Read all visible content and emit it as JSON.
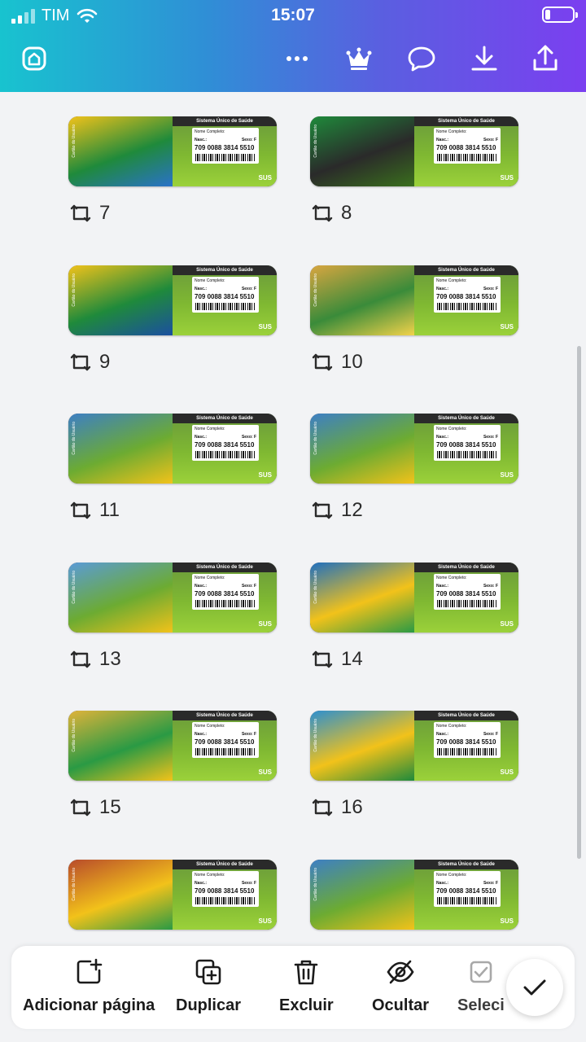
{
  "status_bar": {
    "carrier": "TIM",
    "time": "15:07"
  },
  "toolbar": {
    "icons": [
      "home-icon",
      "more-icon",
      "crown-icon",
      "comment-icon",
      "download-icon",
      "share-icon"
    ]
  },
  "card_text": {
    "system": "Sistema Único de Saúde",
    "name_label": "Nome Completo:",
    "birth_label": "Nasc.:",
    "sex_label": "Sexo: F",
    "number": "709 0088 3814 5510",
    "sus": "SUS",
    "side": "Cartão do Usuário"
  },
  "pages": [
    {
      "label": "7"
    },
    {
      "label": "8"
    },
    {
      "label": "9"
    },
    {
      "label": "10"
    },
    {
      "label": "11"
    },
    {
      "label": "12"
    },
    {
      "label": "13"
    },
    {
      "label": "14"
    },
    {
      "label": "15"
    },
    {
      "label": "16"
    },
    {
      "label": ""
    },
    {
      "label": ""
    }
  ],
  "actions": {
    "add_page": "Adicionar página",
    "duplicate": "Duplicar",
    "delete": "Excluir",
    "hide": "Ocultar",
    "select": "Seleci"
  },
  "colors": {
    "header_start": "#18c3cf",
    "header_end": "#7b3ff0",
    "card_dark": "#2b2b2b",
    "field_green": "#7fb832"
  }
}
